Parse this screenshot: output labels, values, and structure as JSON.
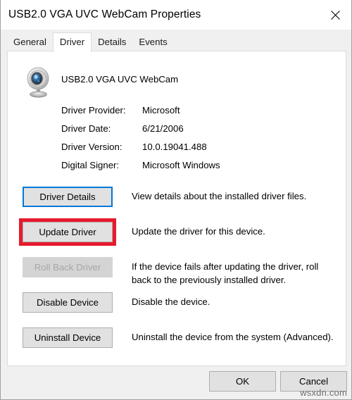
{
  "window": {
    "title": "USB2.0 VGA UVC WebCam Properties",
    "close_icon": "close-icon"
  },
  "tabs": [
    {
      "label": "General",
      "active": false
    },
    {
      "label": "Driver",
      "active": true
    },
    {
      "label": "Details",
      "active": false
    },
    {
      "label": "Events",
      "active": false
    }
  ],
  "device": {
    "icon": "webcam-icon",
    "name": "USB2.0 VGA UVC WebCam"
  },
  "properties": [
    {
      "label": "Driver Provider:",
      "value": "Microsoft"
    },
    {
      "label": "Driver Date:",
      "value": "6/21/2006"
    },
    {
      "label": "Driver Version:",
      "value": "10.0.19041.488"
    },
    {
      "label": "Digital Signer:",
      "value": "Microsoft Windows"
    }
  ],
  "actions": [
    {
      "label": "Driver Details",
      "description": "View details about the installed driver files.",
      "state": "focused"
    },
    {
      "label": "Update Driver",
      "description": "Update the driver for this device.",
      "state": "highlighted"
    },
    {
      "label": "Roll Back Driver",
      "description": "If the device fails after updating the driver, roll back to the previously installed driver.",
      "state": "disabled"
    },
    {
      "label": "Disable Device",
      "description": "Disable the device.",
      "state": "normal"
    },
    {
      "label": "Uninstall Device",
      "description": "Uninstall the device from the system (Advanced).",
      "state": "normal"
    }
  ],
  "footer": {
    "ok_label": "OK",
    "cancel_label": "Cancel"
  },
  "watermark": "wsxdn.com",
  "colors": {
    "highlight": "#e8192c",
    "focus": "#0078d7",
    "button_face": "#e1e1e1",
    "dialog_face": "#f0f0f0"
  }
}
